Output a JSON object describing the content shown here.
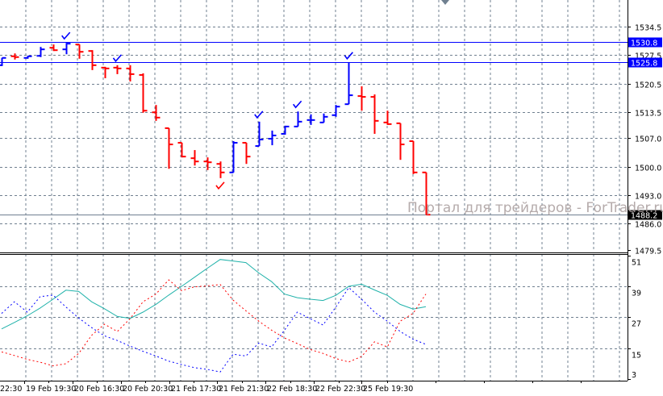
{
  "chart_data": [
    {
      "type": "ohlc-bars",
      "symbol_panel": "main",
      "ylim": [
        1479.5,
        1534.5
      ],
      "y_ticks": [
        "1534.5",
        "1527.5",
        "1520.5",
        "1513.5",
        "1507.0",
        "1500.0",
        "1493.0",
        "1486.0",
        "1479.5"
      ],
      "y_tick_values": [
        1534.5,
        1527.5,
        1520.5,
        1513.5,
        1507.0,
        1500.0,
        1493.0,
        1486.0,
        1479.5
      ],
      "x_tick_labels": [
        "22:30",
        "19 Feb 19:30",
        "20 Feb 16:30",
        "20 Feb 20:30",
        "21 Feb 17:30",
        "21 Feb 21:30",
        "22 Feb 18:30",
        "22 Feb 22:30",
        "25 Feb 19:30"
      ],
      "grid": true,
      "up_color": "#0000ff",
      "down_color": "#ff0000",
      "bars": [
        [
          1525.0,
          1526.8,
          1524.8,
          1526.8
        ],
        [
          1527.2,
          1527.9,
          1526.4,
          1527.0
        ],
        [
          1526.8,
          1527.3,
          1526.6,
          1527.2
        ],
        [
          1527.3,
          1529.5,
          1527.0,
          1528.9
        ],
        [
          1529.3,
          1530.1,
          1528.5,
          1528.7
        ],
        [
          1528.9,
          1530.5,
          1527.7,
          1530.3
        ],
        [
          1530.1,
          1530.1,
          1526.6,
          1528.3
        ],
        [
          1528.5,
          1528.7,
          1523.8,
          1525.0
        ],
        [
          1524.4,
          1524.6,
          1521.8,
          1524.2
        ],
        [
          1524.4,
          1525.0,
          1522.8,
          1524.2
        ],
        [
          1524.2,
          1525.0,
          1521.0,
          1522.8
        ],
        [
          1522.6,
          1523.0,
          1513.3,
          1513.8
        ],
        [
          1513.4,
          1515.2,
          1511.3,
          1512.1
        ],
        [
          1509.5,
          1509.5,
          1499.5,
          1505.5
        ],
        [
          1505.9,
          1505.9,
          1502.3,
          1502.5
        ],
        [
          1502.1,
          1504.1,
          1500.3,
          1501.3
        ],
        [
          1501.3,
          1502.3,
          1499.2,
          1501.1
        ],
        [
          1500.7,
          1501.3,
          1497.2,
          1498.6
        ],
        [
          1498.6,
          1506.3,
          1498.6,
          1505.9
        ],
        [
          1505.9,
          1505.9,
          1500.7,
          1502.5
        ],
        [
          1505.1,
          1511.1,
          1505.1,
          1506.7
        ],
        [
          1506.9,
          1508.9,
          1505.3,
          1507.7
        ],
        [
          1508.1,
          1510.1,
          1507.9,
          1509.9
        ],
        [
          1509.9,
          1513.6,
          1509.9,
          1511.1
        ],
        [
          1511.5,
          1512.9,
          1510.3,
          1511.5
        ],
        [
          1510.9,
          1513.1,
          1510.9,
          1512.3
        ],
        [
          1512.7,
          1515.2,
          1512.3,
          1514.8
        ],
        [
          1515.4,
          1525.6,
          1515.4,
          1517.6
        ],
        [
          1517.4,
          1519.8,
          1513.8,
          1517.2
        ],
        [
          1517.2,
          1517.8,
          1508.1,
          1511.3
        ],
        [
          1510.9,
          1513.8,
          1510.3,
          1510.5
        ],
        [
          1510.7,
          1510.7,
          1501.7,
          1505.5
        ],
        [
          1506.3,
          1506.3,
          1498.2,
          1498.6
        ],
        [
          1498.6,
          1498.6,
          1488.2,
          1488.2
        ]
      ],
      "horizontal_lines": [
        {
          "value": 1530.8,
          "label": "1530.8",
          "color": "#0000ff"
        },
        {
          "value": 1525.8,
          "label": "1525.8",
          "color": "#0000ff"
        }
      ],
      "current_price": {
        "value": 1488.2,
        "label": "1488.2",
        "color": "#000000"
      },
      "marks_up_bars": [
        5,
        9,
        20,
        23,
        27
      ],
      "marks_down_bars": [
        17
      ],
      "up_mark_color": "#0000ff",
      "down_mark_color": "#ff0000"
    },
    {
      "type": "line",
      "symbol_panel": "indicator",
      "ylim": [
        3,
        51
      ],
      "y_ticks": [
        "51",
        "39",
        "27",
        "15",
        "3"
      ],
      "y_tick_values": [
        51,
        39,
        27,
        15,
        3
      ],
      "grid": true,
      "series": [
        {
          "color": "#20b2aa",
          "style": "solid",
          "values": [
            22.5,
            25,
            27.6,
            30.6,
            34,
            37.5,
            37,
            33,
            30.3,
            27.3,
            26.6,
            29,
            32,
            35.6,
            39,
            42.5,
            46,
            49.4,
            48.8,
            48.2,
            44.2,
            40.8,
            36,
            34.6,
            34,
            33.5,
            35.5,
            39,
            39.8,
            37.6,
            35.5,
            32,
            30.2,
            31.1
          ]
        },
        {
          "color": "#ff0000",
          "style": "dashed",
          "values": [
            13.6,
            12.2,
            10.7,
            9.6,
            8.2,
            9,
            13,
            20,
            24.3,
            21.5,
            26.5,
            33,
            36,
            41.5,
            37.3,
            38.8,
            39.2,
            39.7,
            33.7,
            29.5,
            25.5,
            22,
            19,
            16.8,
            14.5,
            13,
            11,
            9.7,
            11.8,
            17.5,
            15.5,
            25.5,
            28.5,
            36
          ]
        },
        {
          "color": "#0000ff",
          "style": "dashed",
          "values": [
            28.5,
            33,
            29,
            35,
            35.6,
            31,
            26.7,
            23,
            19.8,
            18,
            15.8,
            13.8,
            12,
            10,
            8.7,
            7.5,
            6.8,
            5.8,
            12.7,
            12,
            17,
            15.5,
            22,
            29,
            26.5,
            24,
            31,
            38.5,
            34,
            29,
            25.5,
            21.5,
            18.5,
            16.5
          ]
        }
      ]
    }
  ],
  "watermark": "Портал для трейдеров - ForTrader.ru",
  "colors": {
    "grid": "#708090",
    "background": "#ffffff",
    "axis": "#000000"
  }
}
